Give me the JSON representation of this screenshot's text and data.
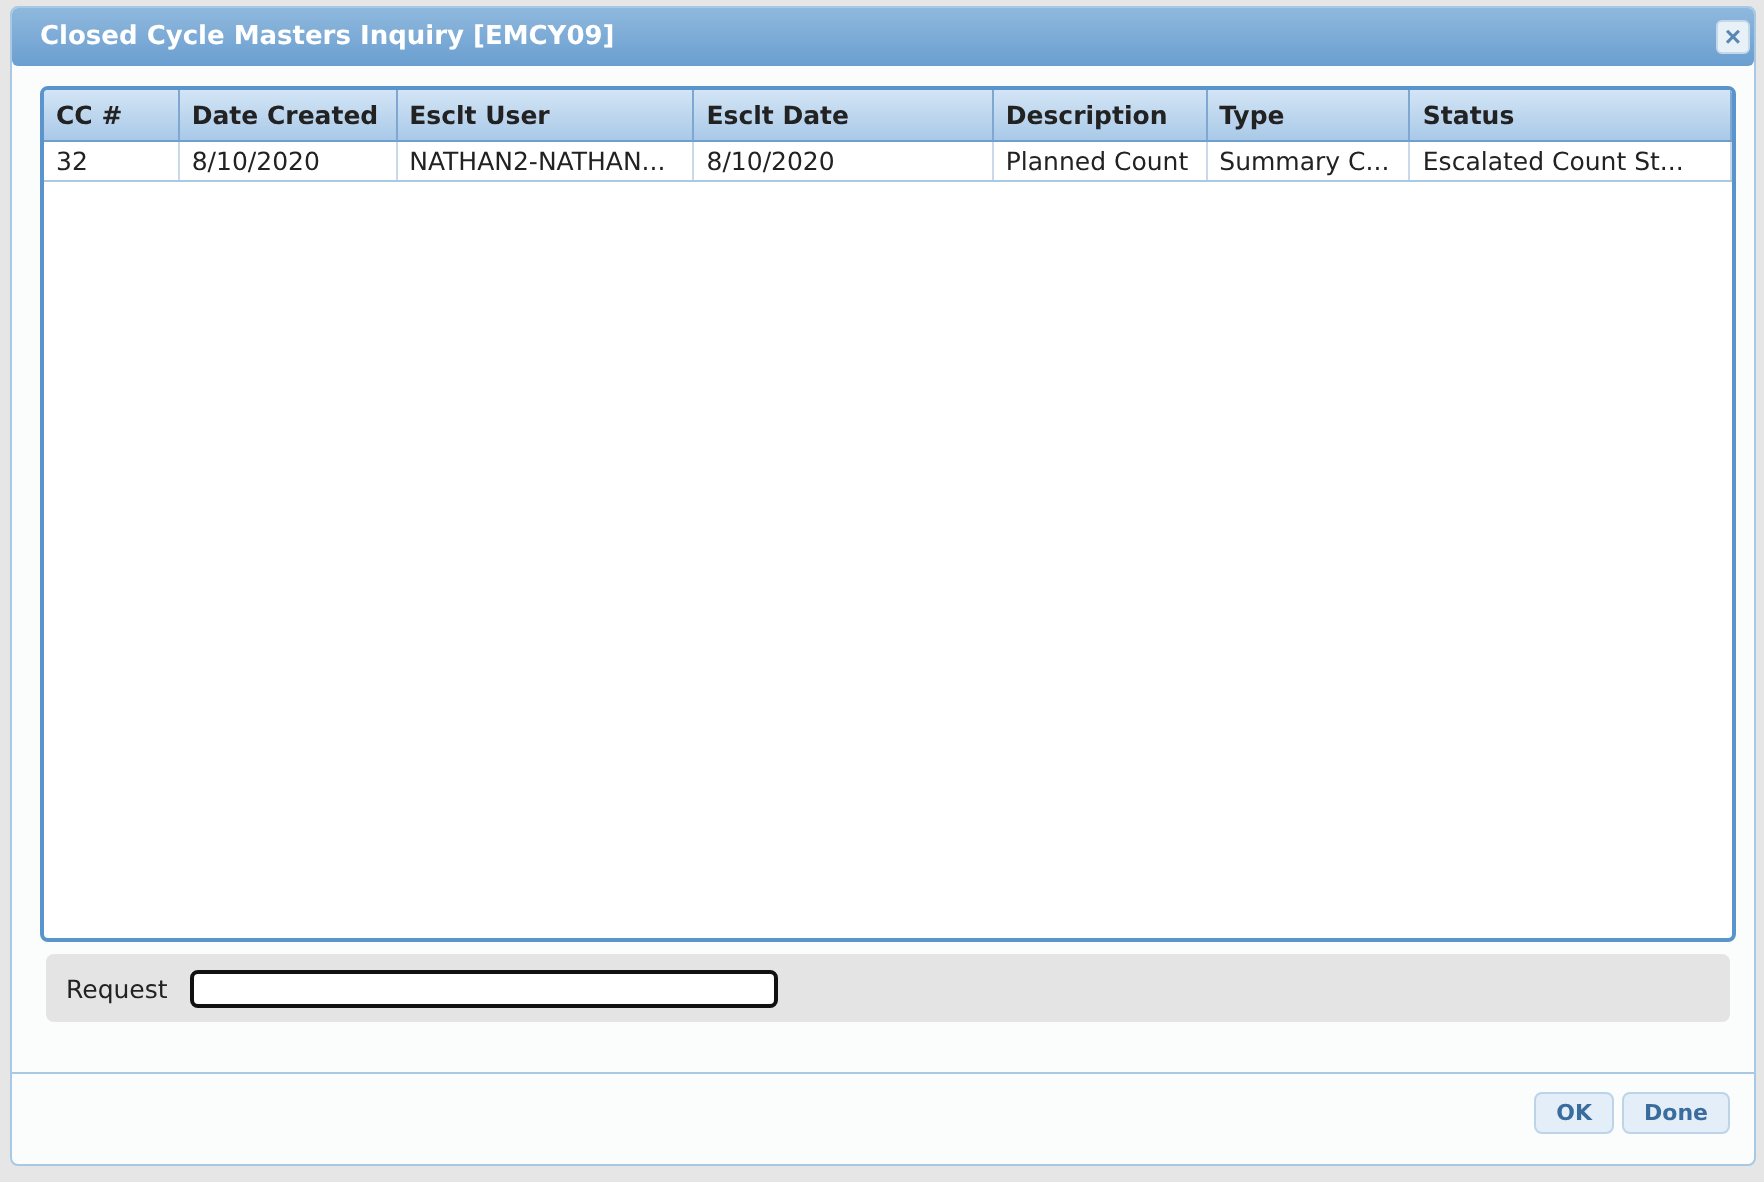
{
  "window": {
    "title": "Closed Cycle Masters Inquiry [EMCY09]",
    "close": "×"
  },
  "table": {
    "columns": [
      "CC #",
      "Date Created",
      "Esclt User",
      "Esclt Date",
      "Description",
      "Type",
      "Status"
    ],
    "rows": [
      {
        "selected": false,
        "cells": [
          "32",
          "8/10/2020",
          "NATHAN2-NATHAN...",
          "8/10/2020",
          "Planned Count",
          "Summary C...",
          "Escalated Count St..."
        ]
      }
    ]
  },
  "request": {
    "label": "Request"
  },
  "buttons": [
    "OK",
    "Done"
  ]
}
